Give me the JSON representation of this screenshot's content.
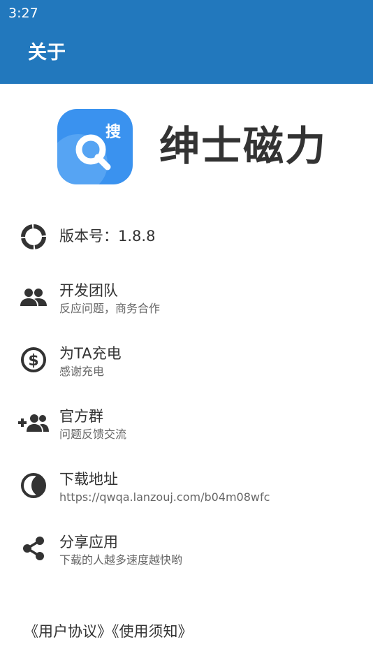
{
  "status_bar": {
    "time": "3:27"
  },
  "header": {
    "title": "关于"
  },
  "app": {
    "name": "绅士磁力",
    "logo_badge_text": "搜",
    "logo_colors": {
      "outer": "#3a92ef",
      "inner": "#6db2f6",
      "glyph": "#ffffff"
    }
  },
  "menu": {
    "items": [
      {
        "icon": "version-ring-icon",
        "title": "版本号：1.8.8",
        "subtitle": ""
      },
      {
        "icon": "group-icon",
        "title": "开发团队",
        "subtitle": "反应问题，商务合作"
      },
      {
        "icon": "dollar-circle-icon",
        "title": "为TA充电",
        "subtitle": "感谢充电"
      },
      {
        "icon": "group-add-icon",
        "title": "官方群",
        "subtitle": "问题反馈交流"
      },
      {
        "icon": "contrast-circle-icon",
        "title": "下载地址",
        "subtitle": "https://qwqa.lanzouj.com/b04m08wfc"
      },
      {
        "icon": "share-icon",
        "title": "分享应用",
        "subtitle": "下载的人越多速度越快哟"
      }
    ]
  },
  "footer": {
    "user_agreement": "《用户协议》",
    "usage_notice": "《使用须知》"
  },
  "colors": {
    "header_bg": "#2278bd",
    "header_text": "#ffffff",
    "text_primary": "#333333",
    "text_secondary": "#666666",
    "icon": "#333333"
  }
}
